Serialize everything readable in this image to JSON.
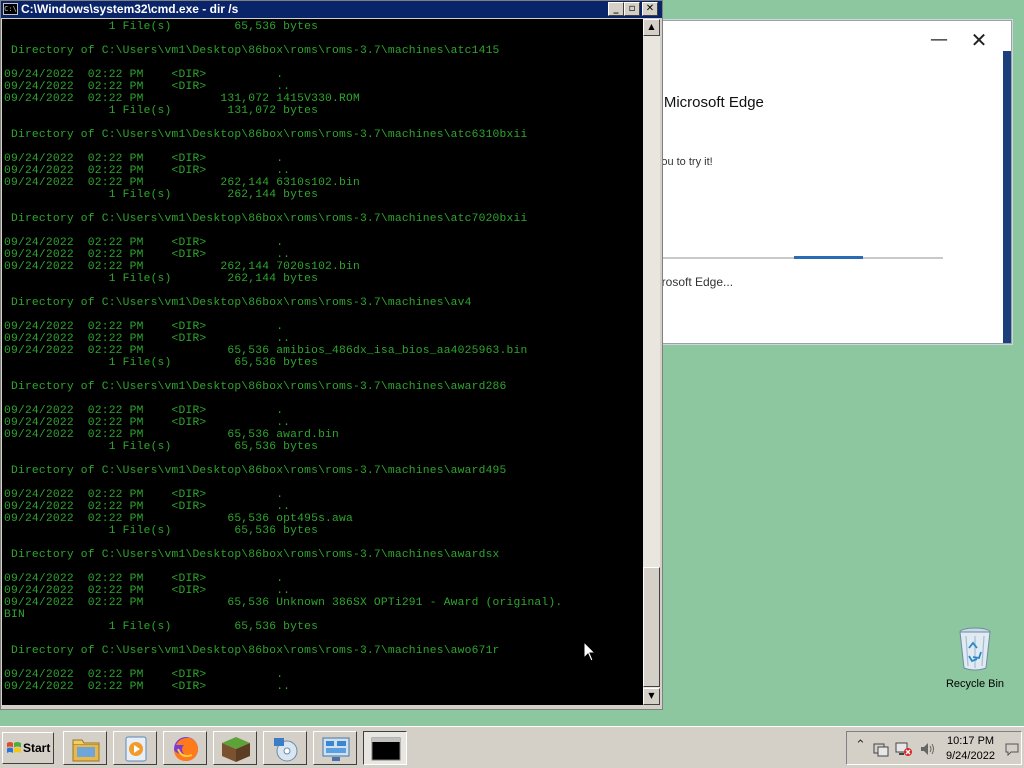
{
  "edge_popup": {
    "title": "ng Microsoft Edge",
    "subtitle": "or you to try it!",
    "status": "Microsoft Edge...",
    "minimize_glyph": "—",
    "close_glyph": "✕",
    "progress_fraction": 0.23
  },
  "console": {
    "title": "C:\\Windows\\system32\\cmd.exe - dir  /s",
    "icon_text": "C:\\",
    "minimize_glyph": "_",
    "maximize_glyph": "▫",
    "close_glyph": "✕",
    "lines": [
      "               1 File(s)         65,536 bytes",
      "",
      " Directory of C:\\Users\\vm1\\Desktop\\86box\\roms\\roms-3.7\\machines\\atc1415",
      "",
      "09/24/2022  02:22 PM    <DIR>          .",
      "09/24/2022  02:22 PM    <DIR>          ..",
      "09/24/2022  02:22 PM           131,072 1415V330.ROM",
      "               1 File(s)        131,072 bytes",
      "",
      " Directory of C:\\Users\\vm1\\Desktop\\86box\\roms\\roms-3.7\\machines\\atc6310bxii",
      "",
      "09/24/2022  02:22 PM    <DIR>          .",
      "09/24/2022  02:22 PM    <DIR>          ..",
      "09/24/2022  02:22 PM           262,144 6310s102.bin",
      "               1 File(s)        262,144 bytes",
      "",
      " Directory of C:\\Users\\vm1\\Desktop\\86box\\roms\\roms-3.7\\machines\\atc7020bxii",
      "",
      "09/24/2022  02:22 PM    <DIR>          .",
      "09/24/2022  02:22 PM    <DIR>          ..",
      "09/24/2022  02:22 PM           262,144 7020s102.bin",
      "               1 File(s)        262,144 bytes",
      "",
      " Directory of C:\\Users\\vm1\\Desktop\\86box\\roms\\roms-3.7\\machines\\av4",
      "",
      "09/24/2022  02:22 PM    <DIR>          .",
      "09/24/2022  02:22 PM    <DIR>          ..",
      "09/24/2022  02:22 PM            65,536 amibios_486dx_isa_bios_aa4025963.bin",
      "               1 File(s)         65,536 bytes",
      "",
      " Directory of C:\\Users\\vm1\\Desktop\\86box\\roms\\roms-3.7\\machines\\award286",
      "",
      "09/24/2022  02:22 PM    <DIR>          .",
      "09/24/2022  02:22 PM    <DIR>          ..",
      "09/24/2022  02:22 PM            65,536 award.bin",
      "               1 File(s)         65,536 bytes",
      "",
      " Directory of C:\\Users\\vm1\\Desktop\\86box\\roms\\roms-3.7\\machines\\award495",
      "",
      "09/24/2022  02:22 PM    <DIR>          .",
      "09/24/2022  02:22 PM    <DIR>          ..",
      "09/24/2022  02:22 PM            65,536 opt495s.awa",
      "               1 File(s)         65,536 bytes",
      "",
      " Directory of C:\\Users\\vm1\\Desktop\\86box\\roms\\roms-3.7\\machines\\awardsx",
      "",
      "09/24/2022  02:22 PM    <DIR>          .",
      "09/24/2022  02:22 PM    <DIR>          ..",
      "09/24/2022  02:22 PM            65,536 Unknown 386SX OPTi291 - Award (original).",
      "BIN",
      "               1 File(s)         65,536 bytes",
      "",
      " Directory of C:\\Users\\vm1\\Desktop\\86box\\roms\\roms-3.7\\machines\\awo671r",
      "",
      "09/24/2022  02:22 PM    <DIR>          .",
      "09/24/2022  02:22 PM    <DIR>          .."
    ]
  },
  "desktop": {
    "recycle_bin_label": "Recycle Bin"
  },
  "taskbar": {
    "start_label": "Start",
    "pinned": [
      {
        "name": "explorer",
        "icon": "folder-icon"
      },
      {
        "name": "media",
        "icon": "media-player-icon"
      },
      {
        "name": "firefox",
        "icon": "firefox-icon"
      },
      {
        "name": "minecraft",
        "icon": "minecraft-icon"
      },
      {
        "name": "disc-tool",
        "icon": "disc-icon"
      },
      {
        "name": "control-panel",
        "icon": "control-panel-icon"
      },
      {
        "name": "cmd",
        "icon": "cmd-icon"
      }
    ],
    "cmd_icon_text": "C:\\_",
    "tray": {
      "expand_glyph": "⌃",
      "time": "10:17 PM",
      "date": "9/24/2022"
    }
  },
  "colors": {
    "desktop": "#8cc7a0",
    "console_text": "#2ea62e",
    "title_bar": "#0a246a"
  }
}
